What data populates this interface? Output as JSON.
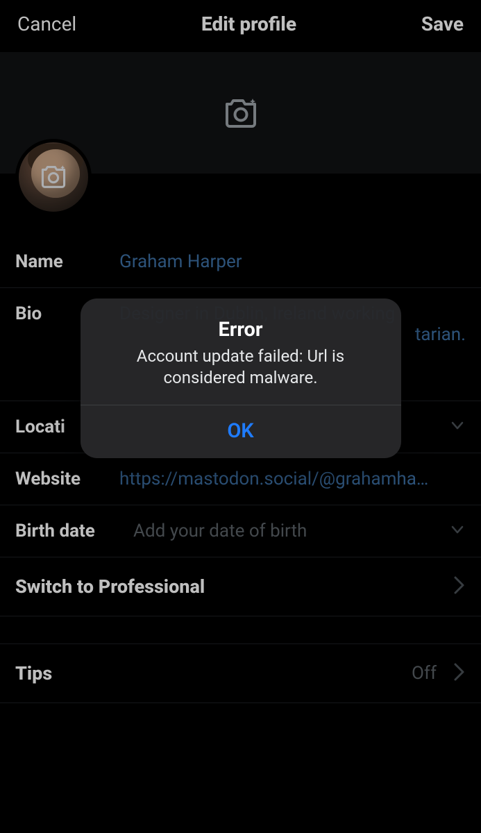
{
  "header": {
    "cancel_label": "Cancel",
    "title": "Edit profile",
    "save_label": "Save"
  },
  "fields": {
    "name": {
      "label": "Name",
      "value": "Graham Harper"
    },
    "bio": {
      "label": "Bio",
      "line1": "Designer in Dublin, Ireland working",
      "line2_suffix": "tarian."
    },
    "location": {
      "label": "Locati"
    },
    "website": {
      "label": "Website",
      "value": "https://mastodon.social/@grahamha…"
    },
    "birth": {
      "label": "Birth date",
      "placeholder": "Add your date of birth"
    }
  },
  "switch_pro": {
    "label": "Switch to Professional"
  },
  "tips": {
    "label": "Tips",
    "state": "Off"
  },
  "alert": {
    "title": "Error",
    "message": "Account update failed: Url is considered malware.",
    "ok_label": "OK"
  },
  "colors": {
    "link": "#3d6fa3",
    "accent": "#1f7cff"
  }
}
